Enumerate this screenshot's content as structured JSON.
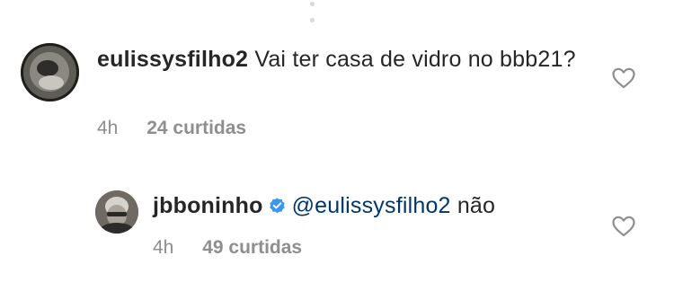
{
  "comments": [
    {
      "username": "eulissysfilho2",
      "text": "Vai ter casa de vidro no bbb21?",
      "time": "4h",
      "likes": "24 curtidas"
    }
  ],
  "reply": {
    "username": "jbboninho",
    "verified": true,
    "mention": "@eulissysfilho2",
    "text": "não",
    "time": "4h",
    "likes": "49 curtidas"
  },
  "colors": {
    "text": "#262626",
    "muted": "#8e8e8e",
    "mention": "#00376b",
    "verified_badge": "#3897f0"
  },
  "icons": {
    "like": "heart-outline-icon",
    "verified": "verified-badge-icon"
  }
}
